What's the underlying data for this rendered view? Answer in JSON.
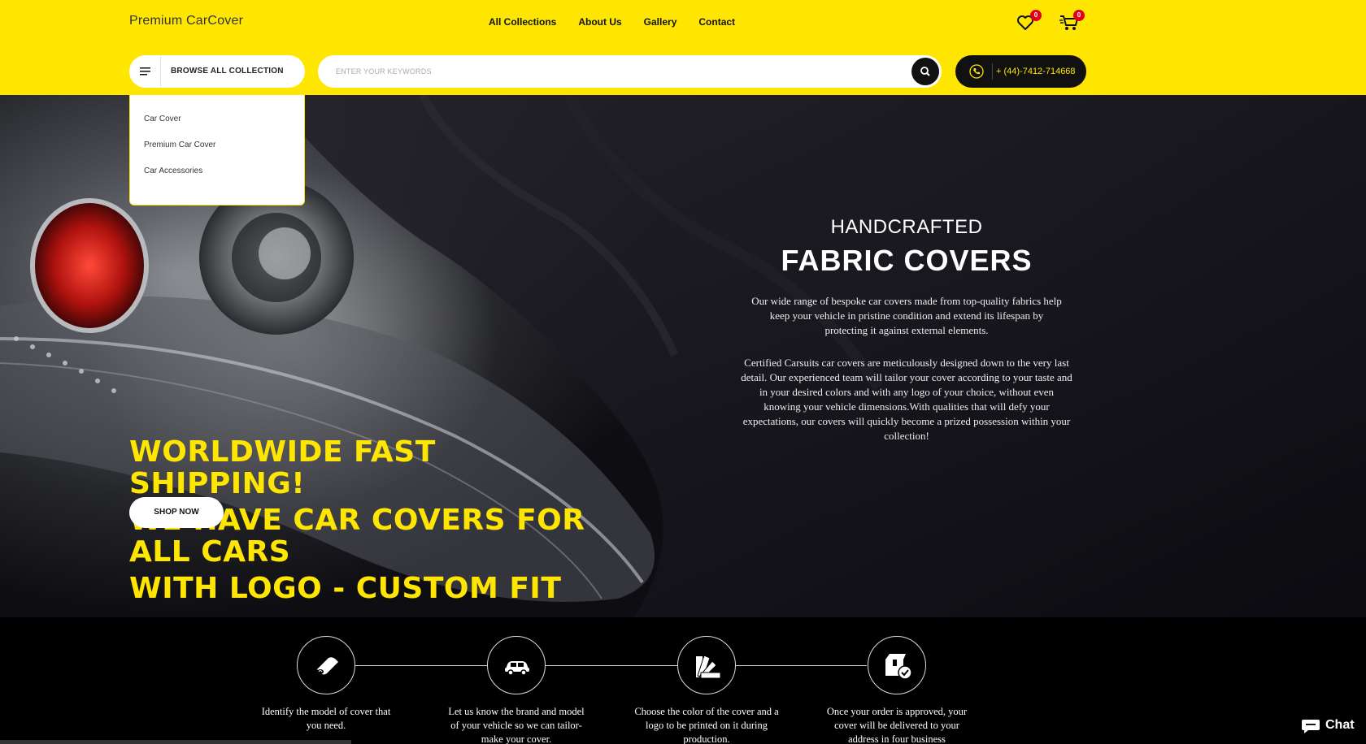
{
  "header": {
    "logo": "Premium CarCover",
    "nav": [
      "All Collections",
      "About Us",
      "Gallery",
      "Contact"
    ],
    "wishlist_count": "0",
    "cart_count": "0",
    "browse_label": "BROWSE ALL COLLECTION",
    "search_placeholder": "ENTER YOUR KEYWORDS",
    "phone": "+ (44)-7412-714668"
  },
  "dropdown": {
    "items": [
      "Car Cover",
      "Premium Car Cover",
      "Car Accessories"
    ]
  },
  "hero": {
    "headline": [
      "WORLDWIDE FAST SHIPPING!",
      "WE HAVE CAR COVERS FOR ALL CARS",
      "WITH LOGO - CUSTOM FIT"
    ],
    "shop_now": "SHOP NOW",
    "kicker": "HANDCRAFTED",
    "title": "FABRIC COVERS",
    "paragraph1": "Our wide range of bespoke car covers made from top-quality fabrics help keep your vehicle in pristine condition and extend its lifespan by protecting it against external elements.",
    "paragraph2": "Certified Carsuits car covers are meticulously designed down to the very last detail. Our experienced team will tailor your cover according to your taste and in your desired colors and with any logo of your choice, without even knowing your vehicle dimensions.With qualities that will defy your expectations, our covers will quickly become a prized possession within your collection!"
  },
  "steps": [
    {
      "icon": "fabric-roll-icon",
      "text": "Identify the model of cover that you need."
    },
    {
      "icon": "car-icon",
      "text": "Let us know the brand and model of your vehicle so we can tailor-make your cover."
    },
    {
      "icon": "color-swatch-icon",
      "text": "Choose the color of the cover and a logo to be printed on it during production."
    },
    {
      "icon": "delivery-box-icon",
      "text": "Once your order is approved, your cover will be delivered to your address in four business"
    }
  ],
  "chat": {
    "label": "Chat"
  },
  "colors": {
    "accent": "#ffe600",
    "dark": "#111111",
    "badge": "#e0001b"
  }
}
